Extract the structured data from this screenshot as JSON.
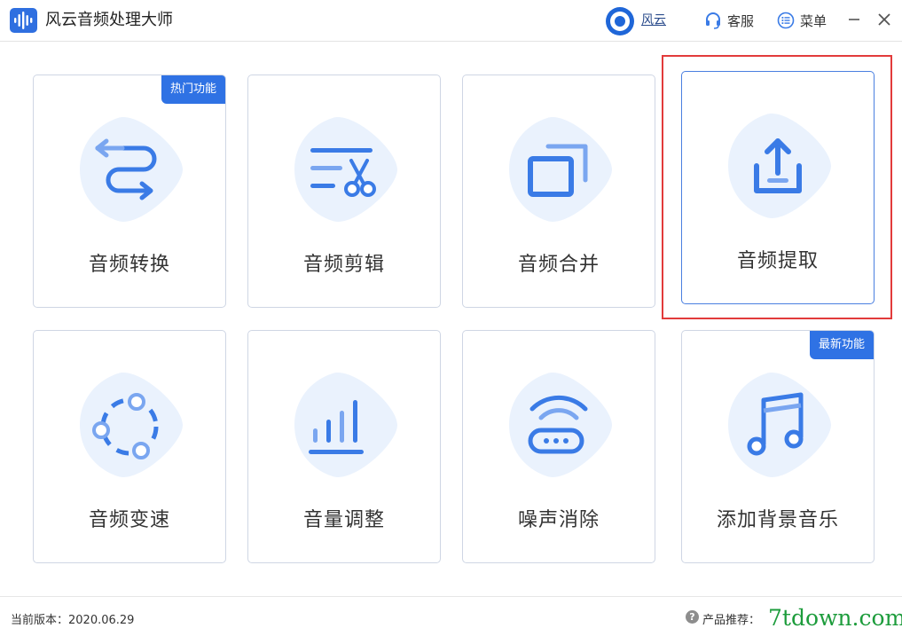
{
  "app": {
    "title": "风云音频处理大师",
    "user_name": "风云",
    "service_label": "客服",
    "menu_label": "菜单"
  },
  "colors": {
    "accent": "#2f72e4",
    "icon_blue": "#3a7be6",
    "icon_light": "#7aa6f0",
    "blob": "#eaf2fd",
    "highlight": "#e23b3b",
    "watermark": "#1d9c3c"
  },
  "cards": [
    {
      "label": "音频转换",
      "icon": "convert-arrows-icon",
      "badge": "热门功能"
    },
    {
      "label": "音频剪辑",
      "icon": "scissors-icon"
    },
    {
      "label": "音频合并",
      "icon": "merge-windows-icon"
    },
    {
      "label": "音频提取",
      "icon": "upload-tray-icon",
      "selected": true
    },
    {
      "label": "音频变速",
      "icon": "speed-circle-icon"
    },
    {
      "label": "音量调整",
      "icon": "volume-bars-icon"
    },
    {
      "label": "噪声消除",
      "icon": "noise-router-icon"
    },
    {
      "label": "添加背景音乐",
      "icon": "music-note-icon",
      "badge": "最新功能"
    }
  ],
  "footer": {
    "version": "当前版本：2020.06.29",
    "recommend": "产品推荐：",
    "help_glyph": "?",
    "watermark": "7tdown.com"
  }
}
